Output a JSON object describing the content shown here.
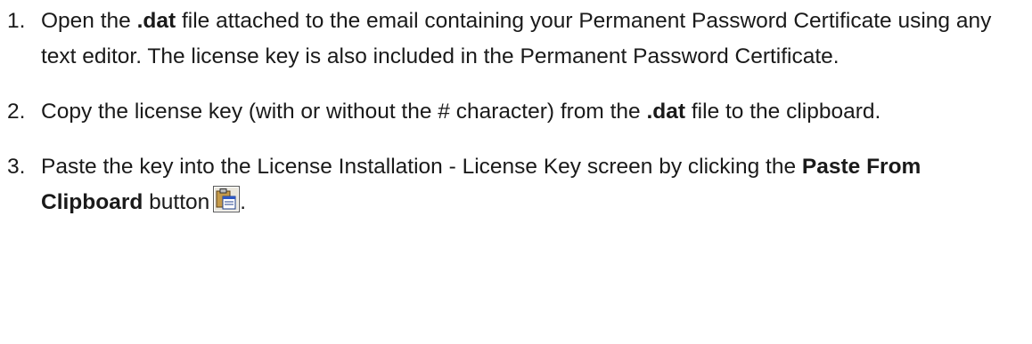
{
  "steps": [
    {
      "number": "1.",
      "pre": "Open the ",
      "bold": ".dat",
      "post": " file attached to the email containing your Permanent Password Certificate using any text editor. The license key is also included in the Permanent Password Certificate."
    },
    {
      "number": "2.",
      "pre": "Copy the license key (with or without the # character) from the ",
      "bold": ".dat",
      "post": " file to the clipboard."
    },
    {
      "number": "3.",
      "pre": "Paste the key into the License Installation - License Key screen by clicking the ",
      "bold": "Paste From Clipboard",
      "post": " button",
      "icon": "paste-from-clipboard-icon",
      "end": "."
    }
  ]
}
